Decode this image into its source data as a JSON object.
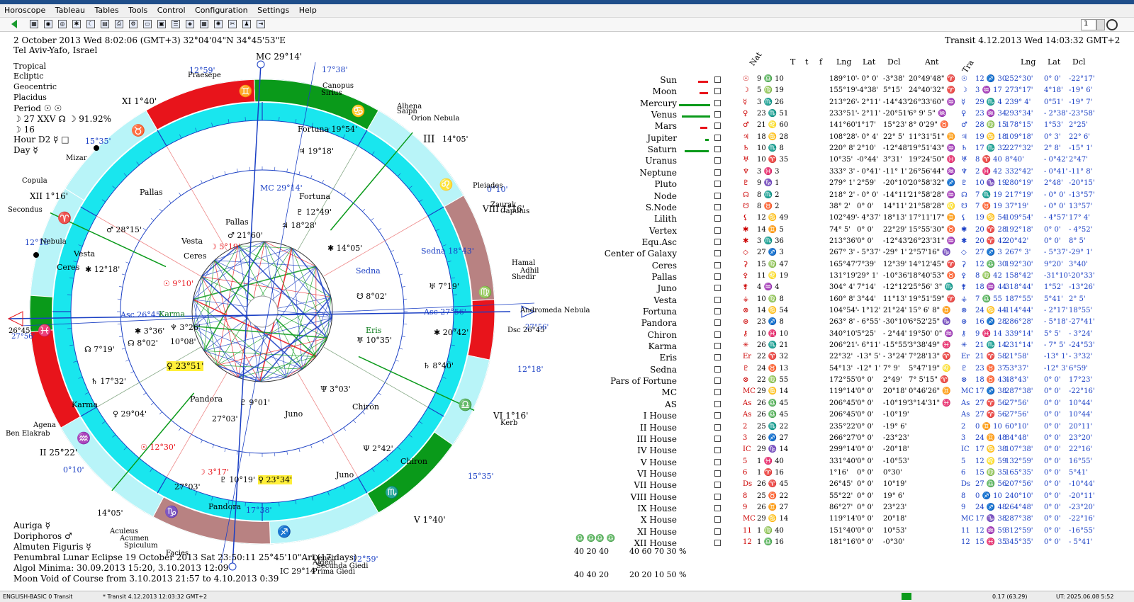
{
  "menu": [
    "Horoscope",
    "Tableau",
    "Tables",
    "Tools",
    "Control",
    "Configuration",
    "Settings",
    "Help"
  ],
  "toolbar": {
    "spin_value": "1"
  },
  "header": {
    "line1": "2 October 2013  Wed   8:02:06 (GMT+3) 32°04'04\"N  34°45'53\"E",
    "line2": "Tel Aviv-Yafo, Israel",
    "transit": "Transit  4.12.2013  Wed 14:03:32 GMT+2"
  },
  "left_info": {
    "lines": [
      "Tropical",
      "Ecliptic",
      "Geocentric",
      "Placidus"
    ],
    "period": "Period ☉ ☉",
    "period_line2": "☽  27 XXV  ☊ ☽ 91.92%",
    "period_line3": "☽  16",
    "hour": "Hour D2 ☿ □",
    "day": "Day ☿"
  },
  "bottom_left": {
    "auriga": "Auriga  ☿",
    "doriphoros": "Doriphoros  ♂",
    "almuten": "Almuten Figuris  ☿",
    "eclipse": "Penumbral Lunar Eclipse 19 October 2013 Sat  23:50:11 25°45'10\"Ari (17 days)",
    "algol": "Algol Minima: 30.09.2013 15:20,  3.10.2013 12:09",
    "moon_void": "Moon Void of Course from 3.10.2013 21:57 to 4.10.2013  0:39"
  },
  "chart_labels": {
    "mc_top": "MC 29°14'",
    "mc_inner": "MC 29°14'",
    "asc_left": "Asc 26°45'",
    "asc_right": "Asc 27°56'",
    "dsc_right": "Dsc 26°45'",
    "dsc_val": "27°56'",
    "left_26": "26°45'",
    "left_27": "27°56'",
    "ic": "IC 29°14'",
    "house_xi": "XI 1°40'",
    "house_xii": "XII 1°16'",
    "house_ii": "II 25°22'",
    "house_iii": "III",
    "house_v": "V 1°40'",
    "house_vi": "VI 1°16'",
    "house_viii": "VIII 1°16'",
    "deg_17_38_top": "17°38'",
    "deg_12_59_top": "12°59'",
    "deg_15_35": "15°35'",
    "deg_14_05": "14°05'",
    "deg_12_18": "12°18'",
    "deg_15_35b": "15°35'",
    "deg_14_05b": "14°05'",
    "deg_12_18b": "12°18'",
    "deg_0_10a": "0°10'",
    "deg_0_10b": "0°10'",
    "deg_12_59b": "12°59'",
    "deg_17_38b": "17°38'",
    "stars": [
      "Praesepe",
      "Canopus",
      "Sirius",
      "Alhena",
      "Saiph",
      "Orion Nebula",
      "Pleiades",
      "Zaurak",
      "Capulus",
      "Hamal",
      "Adhil",
      "Shedir",
      "Andromeda Nebula",
      "Kerb",
      "Mizar",
      "Copula",
      "Secondus",
      "Agena",
      "Ben Elakrab",
      "Aculeus",
      "Acumen",
      "Spiculum",
      "Facies",
      "Deneb",
      "Algedi",
      "Secunda Giedi",
      "Prima Giedi",
      "Nebula"
    ],
    "transit_planets": [
      "Fortuna 19°54'",
      "♃ 19°18'",
      "Pallas",
      "♂ 28°15'",
      "Vesta",
      "Ceres",
      "✱ 12°18'",
      "☊ 7°19'",
      "♄ 17°32'",
      "Karma",
      "♀ 29°04'",
      "Sedna 18°43'",
      "♅ 7°19'",
      "☽ 3°17'",
      "♇ 10°19'",
      "♀ 23°34'",
      "Pandora",
      "☉ 12°30'",
      "27°03'",
      "Juno",
      "Chiron",
      "Ψ 2°42'"
    ],
    "natal_planets": [
      "Fortuna",
      "♇ 12°49'",
      "♃ 18°28'",
      "Pallas",
      "♂ 21°60'",
      "Vesta",
      "☽ 5°19'",
      "Ceres",
      "☉ 9°10'",
      "Sedna",
      "✱ 14°05'",
      "☋ 8°02'",
      "Eris",
      "♅ 10°35'",
      "✱ 20°42'",
      "♄ 8°40'",
      "Ψ 3°03'",
      "Chiron",
      "Juno",
      "♇ 9°01'",
      "27°03'",
      "Pandora",
      "♀ 23°51'",
      "☊ 8°02'",
      "✱ 3°36'",
      "♆ 3°26'",
      "10°08'",
      "Karma"
    ]
  },
  "table": {
    "headers": {
      "nat": "Nat",
      "T": "T",
      "t": "t",
      "f": "f",
      "lng": "Lng",
      "lat": "Lat",
      "dcl": "Dcl",
      "ant": "Ant",
      "tra": "Tra",
      "lng2": "Lng",
      "lat2": "Lat",
      "dcl2": "Dcl"
    },
    "rows": [
      {
        "name": "Sun",
        "sym": "☉",
        "pos": "9 ♎ 10",
        "lng": "189°10'",
        "lat": "- 0° 0'",
        "dcl": "-3°38'",
        "ant": "20°49'48\" ♈",
        "tsym": "☉",
        "tpos": "12 ♐ 30",
        "tlng": "252°30'",
        "tlat": "0° 0'",
        "tdcl": "-22°17'"
      },
      {
        "name": "Moon",
        "sym": "☽",
        "pos": "5 ♍ 19",
        "lng": "155°19'",
        "lat": "-4°38'",
        "dcl": "5°15'",
        "ant": "24°40'32\" ♈",
        "tsym": "☽",
        "tpos": "3 ♒ 17",
        "tlng": "273°17'",
        "tlat": "4°18'",
        "tdcl": "-19° 6'"
      },
      {
        "name": "Mercury",
        "sym": "☿",
        "pos": "3 ♏ 26",
        "lng": "213°26'",
        "lat": "- 2°11'",
        "dcl": "-14°43'",
        "ant": "26°33'60\" ♒",
        "tsym": "☿",
        "tpos": "29 ♏ 4",
        "tlng": "239° 4'",
        "tlat": "0°51'",
        "tdcl": "-19° 7'"
      },
      {
        "name": "Venus",
        "sym": "♀",
        "pos": "23 ♏ 51",
        "lng": "233°51'",
        "lat": "- 2°11'",
        "dcl": "-20°51'",
        "ant": "6° 9' 5\" ♒",
        "tsym": "♀",
        "tpos": "23 ♒ 34",
        "tlng": "293°34'",
        "tlat": "- 2°38'",
        "tdcl": "-23°58'"
      },
      {
        "name": "Mars",
        "sym": "♂",
        "pos": "21 ♌ 60",
        "lng": "141°60'",
        "lat": "1°17'",
        "dcl": "15°23'",
        "ant": "8° 0'29\" ♉",
        "tsym": "♂",
        "tpos": "28 ♍ 15",
        "tlng": "178°15'",
        "tlat": "1°53'",
        "tdcl": "2°25'"
      },
      {
        "name": "Jupiter",
        "sym": "♃",
        "pos": "18 ♋ 28",
        "lng": "108°28'",
        "lat": "- 0° 4'",
        "dcl": "22° 5'",
        "ant": "11°31'51\" ♊",
        "tsym": "♃",
        "tpos": "19 ♋ 18",
        "tlng": "109°18'",
        "tlat": "0° 3'",
        "tdcl": "22° 6'"
      },
      {
        "name": "Saturn",
        "sym": "♄",
        "pos": "10 ♏ 8",
        "lng": "220° 8'",
        "lat": "2°10'",
        "dcl": "-12°48'",
        "ant": "19°51'43\" ♒",
        "tsym": "♄",
        "tpos": "17 ♏ 32",
        "tlng": "227°32'",
        "tlat": "2° 8'",
        "tdcl": "-15° 1'"
      },
      {
        "name": "Uranus",
        "sym": "♅",
        "pos": "10 ♈ 35",
        "lng": "10°35'",
        "lat": "-0°44'",
        "dcl": "3°31'",
        "ant": "19°24'50\" ♓",
        "tsym": "♅",
        "tpos": "8 ♈ 40",
        "tlng": "8°40'",
        "tlat": "- 0°42'",
        "tdcl": "2°47'"
      },
      {
        "name": "Neptune",
        "sym": "♆",
        "pos": "3 ♓ 3",
        "lng": "333° 3'",
        "lat": "- 0°41'",
        "dcl": "-11° 1'",
        "ant": "26°56'44\" ♒",
        "tsym": "♆",
        "tpos": "2 ♓ 42",
        "tlng": "332°42'",
        "tlat": "- 0°41'",
        "tdcl": "-11° 8'"
      },
      {
        "name": "Pluto",
        "sym": "♇",
        "pos": "9 ♑ 1",
        "lng": "279° 1'",
        "lat": "2°59'",
        "dcl": "-20°10'",
        "ant": "20°58'32\" ♐",
        "tsym": "♇",
        "tpos": "10 ♑ 19",
        "tlng": "280°19'",
        "tlat": "2°48'",
        "tdcl": "-20°15'"
      },
      {
        "name": "Node",
        "sym": "☊",
        "pos": "8 ♏ 2",
        "lng": "218° 2'",
        "lat": "- 0° 0'",
        "dcl": "-14°11'",
        "ant": "21°58'28\" ♒",
        "tsym": "☊",
        "tpos": "7 ♏ 19",
        "tlng": "217°19'",
        "tlat": "- 0° 0'",
        "tdcl": "-13°57'"
      },
      {
        "name": "S.Node",
        "sym": "☋",
        "pos": "8 ♉ 2",
        "lng": "38° 2'",
        "lat": "0° 0'",
        "dcl": "14°11'",
        "ant": "21°58'28\" ♌",
        "tsym": "☋",
        "tpos": "7 ♉ 19",
        "tlng": "37°19'",
        "tlat": "- 0° 0'",
        "tdcl": "13°57'"
      },
      {
        "name": "Lilith",
        "sym": "⚸",
        "pos": "12 ♋ 49",
        "lng": "102°49'",
        "lat": "- 4°37'",
        "dcl": "18°13'",
        "ant": "17°11'17\" ♊",
        "tsym": "⚸",
        "tpos": "19 ♋ 54",
        "tlng": "109°54'",
        "tlat": "- 4°57'",
        "tdcl": "17° 4'"
      },
      {
        "name": "Vertex",
        "sym": "✱",
        "pos": "14 ♊ 5",
        "lng": "74° 5'",
        "lat": "0° 0'",
        "dcl": "22°29'",
        "ant": "15°55'30\" ♉",
        "tsym": "✱",
        "tpos": "20 ♈ 28",
        "tlng": "192°18'",
        "tlat": "0° 0'",
        "tdcl": "- 4°52'"
      },
      {
        "name": "Equ.Asc",
        "sym": "✱",
        "pos": "3 ♏ 36",
        "lng": "213°36'",
        "lat": "0° 0'",
        "dcl": "-12°43'",
        "ant": "26°23'31\" ♒",
        "tsym": "✱",
        "tpos": "20 ♈ 42",
        "tlng": "20°42'",
        "tlat": "0° 0'",
        "tdcl": "8° 5'"
      },
      {
        "name": "Center of Galaxy",
        "sym": "◇",
        "pos": "27 ♐ 3",
        "lng": "267° 3'",
        "lat": "- 5°37'",
        "dcl": "-29° 1'",
        "ant": "2°57'16\" ♑",
        "tsym": "◇",
        "tpos": "27 ♐ 3",
        "tlng": "267° 3'",
        "tlat": "- 5°37'",
        "tdcl": "-29° 1'"
      },
      {
        "name": "Ceres",
        "sym": "⚳",
        "pos": "15 ♍ 47",
        "lng": "165°47'",
        "lat": "7°39'",
        "dcl": "12°39'",
        "ant": "14°12'45\" ♈",
        "tsym": "⚳",
        "tpos": "12 ♎ 30",
        "tlng": "192°30'",
        "tlat": "9°20'",
        "tdcl": "3°40'"
      },
      {
        "name": "Pallas",
        "sym": "⚴",
        "pos": "11 ♌ 19",
        "lng": "131°19'",
        "lat": "29° 1'",
        "dcl": "-10°36'",
        "ant": "18°40'53\" ♉",
        "tsym": "⚴",
        "tpos": "8 ♍ 42",
        "tlng": "158°42'",
        "tlat": "-31°10'",
        "tdcl": "-20°33'"
      },
      {
        "name": "Juno",
        "sym": "⚵",
        "pos": "4 ♒ 4",
        "lng": "304° 4'",
        "lat": "7°14'",
        "dcl": "-12°12'",
        "ant": "25°56' 3\" ♏",
        "tsym": "⚵",
        "tpos": "18 ♒ 44",
        "tlng": "318°44'",
        "tlat": "1°52'",
        "tdcl": "-13°26'"
      },
      {
        "name": "Vesta",
        "sym": "⚶",
        "pos": "10 ♍ 8",
        "lng": "160° 8'",
        "lat": "3°44'",
        "dcl": "11°13'",
        "ant": "19°51'59\" ♈",
        "tsym": "⚶",
        "tpos": "7 ♎ 55",
        "tlng": "187°55'",
        "tlat": "5°41'",
        "tdcl": "2° 5'"
      },
      {
        "name": "Fortuna",
        "sym": "⊗",
        "pos": "14 ♋ 54",
        "lng": "104°54'",
        "lat": "- 1°12'",
        "dcl": "21°24'",
        "ant": "15° 6' 8\" ♊",
        "tsym": "⊗",
        "tpos": "24 ♋ 44",
        "tlng": "114°44'",
        "tlat": "- 2°17'",
        "tdcl": "18°55'"
      },
      {
        "name": "Pandora",
        "sym": "⊛",
        "pos": "23 ♐ 8",
        "lng": "263° 8'",
        "lat": "- 6°55'",
        "dcl": "-30°10'",
        "ant": "6°52'25\" ♑",
        "tsym": "⊛",
        "tpos": "16 ♐ 28",
        "tlng": "286°28'",
        "tlat": "- 5°18'",
        "tdcl": "-27°41'"
      },
      {
        "name": "Chiron",
        "sym": "⚷",
        "pos": "10 ♓ 10",
        "lng": "340°10'",
        "lat": "5°25'",
        "dcl": "- 2°44'",
        "ant": "19°50' 0\" ♒",
        "tsym": "⚷",
        "tpos": "9 ♓ 14",
        "tlng": "339°14'",
        "tlat": "5° 5'",
        "tdcl": "- 3°24'"
      },
      {
        "name": "Karma",
        "sym": "✳",
        "pos": "26 ♏ 21",
        "lng": "206°21'",
        "lat": "- 6°11'",
        "dcl": "-15°55'",
        "ant": "3°38'49\" ♓",
        "tsym": "✳",
        "tpos": "21 ♏ 14",
        "tlng": "231°14'",
        "tlat": "- 7° 5'",
        "tdcl": "-24°53'"
      },
      {
        "name": "Eris",
        "sym": "Er",
        "pos": "22 ♈ 32",
        "lng": "22°32'",
        "lat": "-13° 5'",
        "dcl": "- 3°24'",
        "ant": "7°28'13\" ♈",
        "tsym": "Er",
        "tpos": "21 ♈ 58",
        "tlng": "21°58'",
        "tlat": "-13° 1'",
        "tdcl": "- 3°32'"
      },
      {
        "name": "Sedna",
        "sym": "♇",
        "pos": "24 ♉ 13",
        "lng": "54°13'",
        "lat": "-12° 1'",
        "dcl": "7° 9'",
        "ant": "5°47'19\" ♌",
        "tsym": "♇",
        "tpos": "23 ♉ 37",
        "tlng": "53°37'",
        "tlat": "-12° 3'",
        "tdcl": "6°59'"
      },
      {
        "name": "Pars of Fortune",
        "sym": "⊗",
        "pos": "22 ♍ 55",
        "lng": "172°55'",
        "lat": "0° 0'",
        "dcl": "2°49'",
        "ant": "7° 5'15\" ♈",
        "tsym": "⊗",
        "tpos": "18 ♉ 43",
        "tlng": "48°43'",
        "tlat": "0° 0'",
        "tdcl": "17°23'"
      },
      {
        "name": "MC",
        "sym": "MC",
        "pos": "29 ♋ 14",
        "lng": "119°14'",
        "lat": "0° 0'",
        "dcl": "20°18'",
        "ant": "0°46'26\" ♊",
        "tsym": "MC",
        "tpos": "17 ♐ 38",
        "tlng": "287°38'",
        "tlat": "0° 0'",
        "tdcl": "-22°16'"
      },
      {
        "name": "AS",
        "sym": "As",
        "pos": "26 ♎ 45",
        "lng": "206°45'",
        "lat": "0° 0'",
        "dcl": "-10°19'",
        "ant": "3°14'31\" ♓",
        "tsym": "As",
        "tpos": "27 ♈ 56",
        "tlng": "27°56'",
        "tlat": "0° 0'",
        "tdcl": "10°44'"
      },
      {
        "name": "I House",
        "sym": "As",
        "pos": "26 ♎ 45",
        "lng": "206°45'",
        "lat": "0° 0'",
        "dcl": "-10°19'",
        "ant": "",
        "tsym": "As",
        "tpos": "27 ♈ 56",
        "tlng": "27°56'",
        "tlat": "0° 0'",
        "tdcl": "10°44'"
      },
      {
        "name": "II House",
        "sym": "2",
        "pos": "25 ♏ 22",
        "lng": "235°22'",
        "lat": "0° 0'",
        "dcl": "-19° 6'",
        "ant": "",
        "tsym": "2",
        "tpos": "0 ♊ 10",
        "tlng": "60°10'",
        "tlat": "0° 0'",
        "tdcl": "20°11'"
      },
      {
        "name": "III House",
        "sym": "3",
        "pos": "26 ♐ 27",
        "lng": "266°27'",
        "lat": "0° 0'",
        "dcl": "-23°23'",
        "ant": "",
        "tsym": "3",
        "tpos": "24 ♊ 48",
        "tlng": "84°48'",
        "tlat": "0° 0'",
        "tdcl": "23°20'"
      },
      {
        "name": "IV House",
        "sym": "IC",
        "pos": "29 ♑ 14",
        "lng": "299°14'",
        "lat": "0° 0'",
        "dcl": "-20°18'",
        "ant": "",
        "tsym": "IC",
        "tpos": "17 ♋ 38",
        "tlng": "107°38'",
        "tlat": "0° 0'",
        "tdcl": "22°16'"
      },
      {
        "name": "V House",
        "sym": "5",
        "pos": "1 ♓ 40",
        "lng": "331°40'",
        "lat": "0° 0'",
        "dcl": "-10°53'",
        "ant": "",
        "tsym": "5",
        "tpos": "12 ♌ 59",
        "tlng": "132°59'",
        "tlat": "0° 0'",
        "tdcl": "16°55'"
      },
      {
        "name": "VI House",
        "sym": "6",
        "pos": "1 ♈ 16",
        "lng": "1°16'",
        "lat": "0° 0'",
        "dcl": "0°30'",
        "ant": "",
        "tsym": "6",
        "tpos": "15 ♍ 35",
        "tlng": "165°35'",
        "tlat": "0° 0'",
        "tdcl": "5°41'"
      },
      {
        "name": "VII House",
        "sym": "Ds",
        "pos": "26 ♈ 45",
        "lng": "26°45'",
        "lat": "0° 0'",
        "dcl": "10°19'",
        "ant": "",
        "tsym": "Ds",
        "tpos": "27 ♎ 56",
        "tlng": "207°56'",
        "tlat": "0° 0'",
        "tdcl": "-10°44'"
      },
      {
        "name": "VIII House",
        "sym": "8",
        "pos": "25 ♉ 22",
        "lng": "55°22'",
        "lat": "0° 0'",
        "dcl": "19° 6'",
        "ant": "",
        "tsym": "8",
        "tpos": "0 ♐ 10",
        "tlng": "240°10'",
        "tlat": "0° 0'",
        "tdcl": "-20°11'"
      },
      {
        "name": "IX House",
        "sym": "9",
        "pos": "26 ♊ 27",
        "lng": "86°27'",
        "lat": "0° 0'",
        "dcl": "23°23'",
        "ant": "",
        "tsym": "9",
        "tpos": "24 ♐ 48",
        "tlng": "264°48'",
        "tlat": "0° 0'",
        "tdcl": "-23°20'"
      },
      {
        "name": "X House",
        "sym": "MC",
        "pos": "29 ♋ 14",
        "lng": "119°14'",
        "lat": "0° 0'",
        "dcl": "20°18'",
        "ant": "",
        "tsym": "MC",
        "tpos": "17 ♑ 38",
        "tlng": "287°38'",
        "tlat": "0° 0'",
        "tdcl": "-22°16'"
      },
      {
        "name": "XI House",
        "sym": "11",
        "pos": "1 ♍ 40",
        "lng": "151°40'",
        "lat": "0° 0'",
        "dcl": "10°53'",
        "ant": "",
        "tsym": "11",
        "tpos": "12 ♒ 59",
        "tlng": "312°59'",
        "tlat": "0° 0'",
        "tdcl": "-16°55'"
      },
      {
        "name": "XII House",
        "sym": "12",
        "pos": "1 ♎ 16",
        "lng": "181°16'",
        "lat": "0° 0'",
        "dcl": "-0°30'",
        "ant": "",
        "tsym": "12",
        "tpos": "15 ♓ 35",
        "tlng": "345°35'",
        "tlat": "0° 0'",
        "tdcl": "- 5°41'"
      }
    ]
  },
  "element_stats": {
    "row1_labels": "♎ ♎♎ ♎",
    "row1_vals": "40  20  40",
    "row2_vals": "40  40  20",
    "right1_vals": "40  60  70  30 %",
    "right2_vals": "20  20  10  50 %"
  },
  "status": {
    "left": "ENGLISH-BASIC  0  Transit",
    "mid": "*  Transit  4.12.2013 12:03:32 GMT+2",
    "coords": "0.17 (63.29)",
    "ut": "UT: 2025.06.08  5:52"
  },
  "colors": {
    "red": "#e8141b",
    "green": "#0a9a1a",
    "cyan": "#19e6ee",
    "taupe": "#b88282",
    "lightcyan": "#b8f4f8",
    "blue": "#1a3fc4"
  }
}
